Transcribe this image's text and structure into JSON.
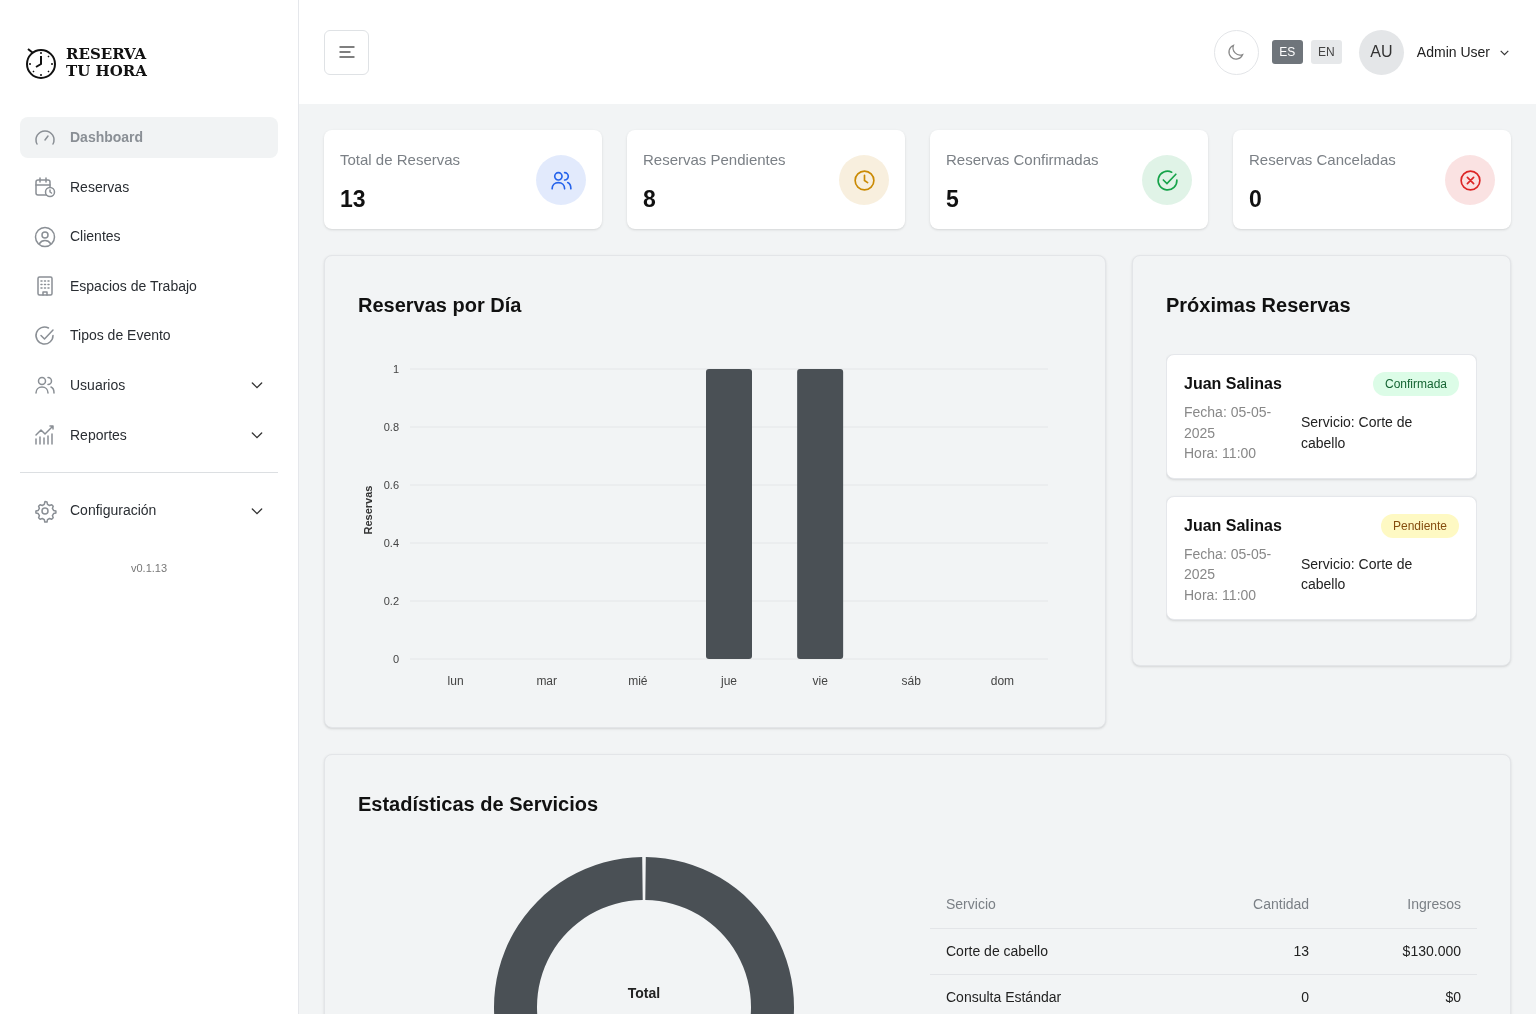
{
  "brand": {
    "line1": "RESERVA",
    "line2": "TU HORA"
  },
  "sidebar": {
    "items": [
      {
        "label": "Dashboard",
        "kind": "link",
        "selected": true
      },
      {
        "label": "Reservas",
        "kind": "link",
        "selected": false
      },
      {
        "label": "Clientes",
        "kind": "link",
        "selected": false
      },
      {
        "label": "Espacios de Trabajo",
        "kind": "link",
        "selected": false
      },
      {
        "label": "Tipos de Evento",
        "kind": "link",
        "selected": false
      },
      {
        "label": "Usuarios",
        "kind": "group",
        "selected": false
      },
      {
        "label": "Reportes",
        "kind": "group",
        "selected": false
      }
    ],
    "footer_items": [
      {
        "label": "Configuración",
        "kind": "group",
        "selected": false
      }
    ],
    "version": "v0.1.13"
  },
  "header": {
    "languages": [
      {
        "label": "ES",
        "selected": true
      },
      {
        "label": "EN",
        "selected": false
      }
    ],
    "avatar": "AU",
    "user": "Admin User"
  },
  "stats": [
    {
      "label": "Total de Reservas",
      "value": "13",
      "kind": "users",
      "color": "#2563eb"
    },
    {
      "label": "Reservas Pendientes",
      "value": "8",
      "kind": "clock",
      "color": "#ca8a04"
    },
    {
      "label": "Reservas Confirmadas",
      "value": "5",
      "kind": "check",
      "color": "#16a34a"
    },
    {
      "label": "Reservas Canceladas",
      "value": "0",
      "kind": "cancel",
      "color": "#dc2626"
    }
  ],
  "daily_chart": {
    "title": "Reservas por Día",
    "chart_data": {
      "type": "bar",
      "ylabel": "Reservas",
      "categories": [
        "lun",
        "mar",
        "mié",
        "jue",
        "vie",
        "sáb",
        "dom"
      ],
      "series": [
        {
          "color": "#4a5055",
          "values": [
            0,
            0,
            0,
            1,
            1,
            0,
            0
          ]
        }
      ],
      "ylim": [
        0,
        1
      ],
      "yticks": [
        0,
        0.2,
        0.4,
        0.6,
        0.8,
        1
      ],
      "grid": true
    }
  },
  "upcoming": {
    "title": "Próximas Reservas",
    "items": [
      {
        "name": "Juan Salinas",
        "status": "Confirmada",
        "kind": "confirmed",
        "date": "Fecha: 05-05-2025",
        "time": "Hora: 11:00",
        "service": "Servicio: Corte de cabello"
      },
      {
        "name": "Juan Salinas",
        "status": "Pendiente",
        "kind": "pending",
        "date": "Fecha: 05-05-2025",
        "time": "Hora: 11:00",
        "service": "Servicio: Corte de cabello"
      }
    ]
  },
  "services": {
    "title": "Estadísticas de Servicios",
    "donut_label": "Total",
    "table": {
      "columns": [
        "Servicio",
        "Cantidad",
        "Ingresos"
      ],
      "rows": [
        [
          "Corte de cabello",
          "13",
          "$130.000"
        ],
        [
          "Consulta Estándar",
          "0",
          "$0"
        ]
      ]
    }
  }
}
